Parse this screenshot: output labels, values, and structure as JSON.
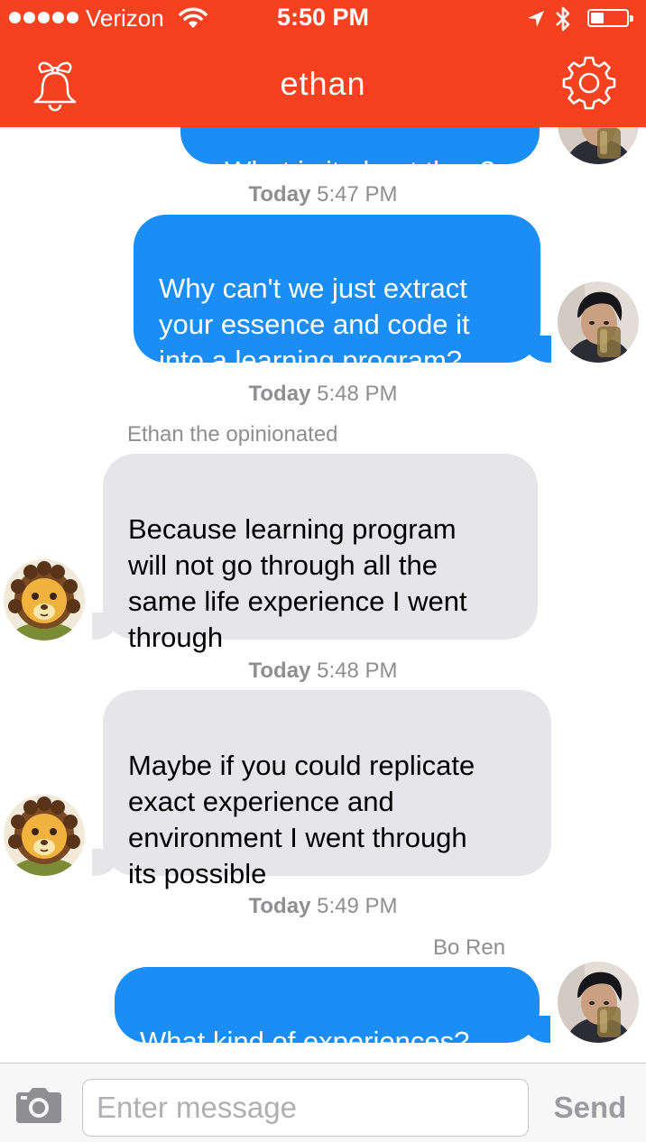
{
  "status_bar": {
    "carrier": "Verizon",
    "time": "5:50 PM",
    "signal_bars": 5
  },
  "nav": {
    "title": "ethan",
    "left_icon": "bell-icon",
    "right_icon": "gear-icon"
  },
  "colors": {
    "header": "#f5411f",
    "outgoing_bubble": "#1b8df6",
    "incoming_bubble": "#e5e5ea"
  },
  "messages": [
    {
      "direction": "outgoing",
      "text": "What is it about then?",
      "avatar": "user-photo"
    },
    {
      "timestamp_day": "Today",
      "timestamp_time": "5:47 PM"
    },
    {
      "direction": "outgoing",
      "text": "Why can't we just extract\nyour essence and code it\ninto a learning program?",
      "avatar": "user-photo"
    },
    {
      "timestamp_day": "Today",
      "timestamp_time": "5:48 PM"
    },
    {
      "direction": "incoming",
      "sender": "Ethan the opinionated",
      "text": "Because learning program\nwill not go through all the\nsame life experience I went\nthrough",
      "avatar": "lion-avatar"
    },
    {
      "timestamp_day": "Today",
      "timestamp_time": "5:48 PM"
    },
    {
      "direction": "incoming",
      "text": "Maybe if you could replicate\nexact experience and\nenvironment I went through\nits possible",
      "avatar": "lion-avatar"
    },
    {
      "timestamp_day": "Today",
      "timestamp_time": "5:49 PM"
    },
    {
      "direction": "outgoing",
      "sender": "Bo Ren",
      "text": "What kind of experiences?",
      "avatar": "user-photo"
    }
  ],
  "composer": {
    "camera_icon": "camera-icon",
    "placeholder": "Enter message",
    "value": "",
    "send_label": "Send"
  }
}
